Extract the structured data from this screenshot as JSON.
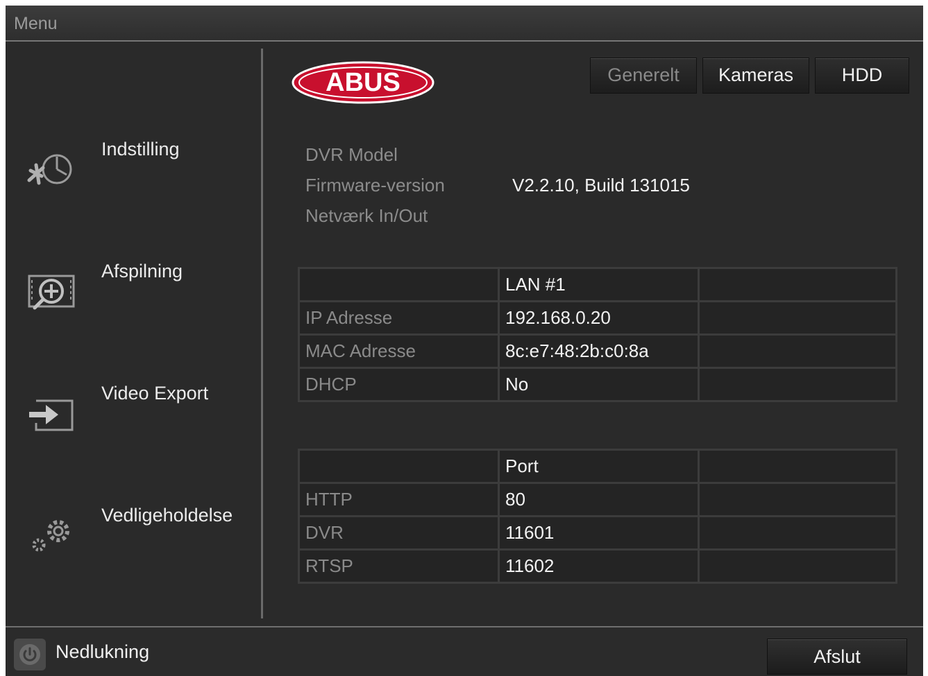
{
  "titlebar": {
    "title": "Menu"
  },
  "sidebar": {
    "items": [
      {
        "label": "Indstilling",
        "icon": "settings-icon"
      },
      {
        "label": "Afspilning",
        "icon": "playback-icon"
      },
      {
        "label": "Video Export",
        "icon": "export-icon"
      },
      {
        "label": "Vedligeholdelse",
        "icon": "maintenance-icon"
      }
    ]
  },
  "logo": {
    "text": "ABUS",
    "color": "#c8102e"
  },
  "tabs": [
    {
      "label": "Generelt",
      "state": "selected"
    },
    {
      "label": "Kameras",
      "state": "normal"
    },
    {
      "label": "HDD",
      "state": "normal"
    }
  ],
  "info": {
    "dvr_model_label": "DVR Model",
    "dvr_model_value": "",
    "firmware_label": "Firmware-version",
    "firmware_value": "V2.2.10, Build 131015",
    "network_label": "Netværk In/Out",
    "network_value": ""
  },
  "lan_table": {
    "header": [
      "",
      "LAN #1",
      ""
    ],
    "rows": [
      [
        "IP Adresse",
        "192.168.0.20",
        ""
      ],
      [
        "MAC Adresse",
        "8c:e7:48:2b:c0:8a",
        ""
      ],
      [
        "DHCP",
        "No",
        ""
      ]
    ]
  },
  "port_table": {
    "header": [
      "",
      "Port",
      ""
    ],
    "rows": [
      [
        "HTTP",
        "80",
        ""
      ],
      [
        "DVR",
        "11601",
        ""
      ],
      [
        "RTSP",
        "11602",
        ""
      ]
    ]
  },
  "bottom": {
    "shutdown_label": "Nedlukning",
    "shutdown_icon": "power-icon",
    "exit_label": "Afslut"
  }
}
